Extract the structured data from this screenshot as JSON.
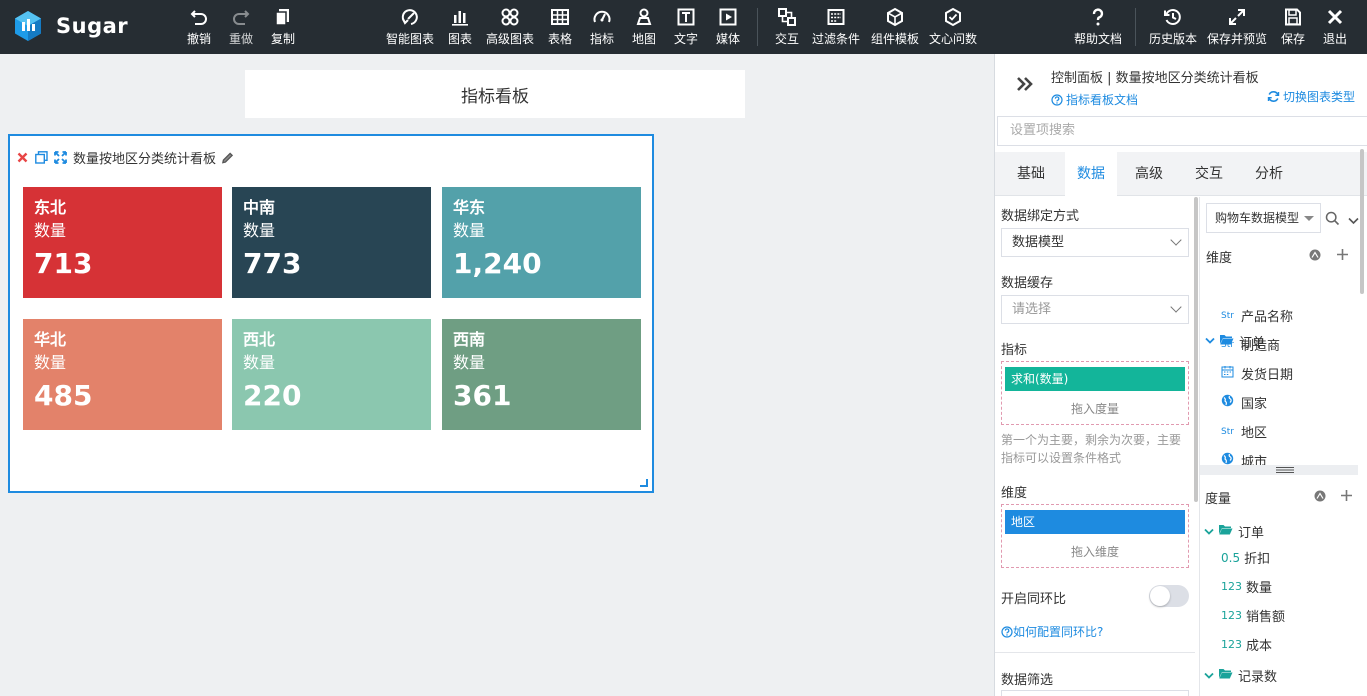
{
  "app": {
    "name": "Sugar",
    "logo_color": "#1e9be8"
  },
  "toolbar": {
    "undo": "撤销",
    "redo": "重做",
    "copy": "复制",
    "smart_chart": "智能图表",
    "chart": "图表",
    "advanced_chart": "高级图表",
    "table": "表格",
    "indicator": "指标",
    "map": "地图",
    "text": "文字",
    "media": "媒体",
    "interaction": "交互",
    "filter": "过滤条件",
    "component_template": "组件模板",
    "wenxin": "文心问数",
    "help": "帮助文档",
    "history": "历史版本",
    "save_preview": "保存并预览",
    "save": "保存",
    "exit": "退出"
  },
  "canvas": {
    "page_title": "指标看板",
    "widget": {
      "title": "数量按地区分类统计看板",
      "cards": [
        {
          "region": "东北",
          "metric": "数量",
          "value": "713",
          "color": "#d63236"
        },
        {
          "region": "中南",
          "metric": "数量",
          "value": "773",
          "color": "#284554"
        },
        {
          "region": "华东",
          "metric": "数量",
          "value": "1,240",
          "color": "#53a1aa"
        },
        {
          "region": "华北",
          "metric": "数量",
          "value": "485",
          "color": "#e3826a"
        },
        {
          "region": "西北",
          "metric": "数量",
          "value": "220",
          "color": "#8bc7af"
        },
        {
          "region": "西南",
          "metric": "数量",
          "value": "361",
          "color": "#6f9e83"
        }
      ]
    }
  },
  "panel": {
    "title": "控制面板 | 数量按地区分类统计看板",
    "doc_link": "指标看板文档",
    "switch_link": "切换图表类型",
    "search_placeholder": "设置项搜索",
    "tabs": [
      "基础",
      "数据",
      "高级",
      "交互",
      "分析"
    ],
    "active_tab": "数据",
    "binding_label": "数据绑定方式",
    "binding_value": "数据模型",
    "cache_label": "数据缓存",
    "cache_placeholder": "请选择",
    "metric_label": "指标",
    "metric_chip": "求和(数量)",
    "metric_drop_hint": "拖入度量",
    "metric_hint": "第一个为主要，剩余为次要，主要指标可以设置条件格式",
    "dimension_label": "维度",
    "dimension_chip": "地区",
    "dimension_drop_hint": "拖入维度",
    "yoy_label": "开启同环比",
    "yoy_link": "如何配置同环比?",
    "filter_label": "数据筛选",
    "model_select": "购物车数据模型",
    "dims_group": "维度",
    "dims_folder": "订单",
    "dims": [
      {
        "type": "Str",
        "name": "产品名称"
      },
      {
        "type": "Str",
        "name": "制造商"
      },
      {
        "type": "date",
        "name": "发货日期"
      },
      {
        "type": "geo",
        "name": "国家"
      },
      {
        "type": "Str",
        "name": "地区"
      },
      {
        "type": "geo",
        "name": "城市"
      }
    ],
    "measures_group": "度量",
    "measures_folder": "订单",
    "measures": [
      {
        "type": "0.5",
        "name": "折扣"
      },
      {
        "type": "123",
        "name": "数量"
      },
      {
        "type": "123",
        "name": "销售额"
      },
      {
        "type": "123",
        "name": "成本"
      }
    ],
    "measures_folder2": "记录数",
    "accent": "#1e8be0",
    "chip_metric_color": "#13b59a",
    "chip_dimension_color": "#1e8be0"
  }
}
